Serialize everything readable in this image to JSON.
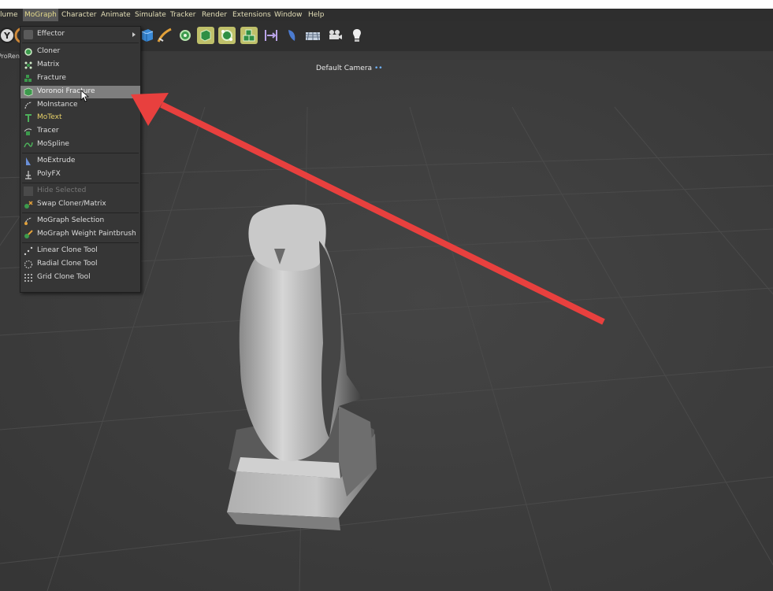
{
  "menubar": {
    "items": [
      {
        "label": "lume"
      },
      {
        "label": "MoGraph",
        "active": true
      },
      {
        "label": "Character"
      },
      {
        "label": "Animate"
      },
      {
        "label": "Simulate"
      },
      {
        "label": "Tracker"
      },
      {
        "label": "Render"
      },
      {
        "label": "Extensions"
      },
      {
        "label": "Window"
      },
      {
        "label": "Help"
      }
    ]
  },
  "toolbar": {
    "icons": [
      "y-axis-icon",
      "rotate-icon",
      "cube-primitive-icon",
      "spline-pen-icon",
      "cloner-icon",
      "extrude-icon",
      "matrix-icon",
      "fracture-icon",
      "joint-icon",
      "deformer-icon",
      "floor-icon",
      "camera-icon",
      "light-icon"
    ]
  },
  "left_stub": {
    "label": "ProRen"
  },
  "viewport": {
    "camera_label": "Default Camera"
  },
  "mograph_menu": {
    "items": [
      {
        "label": "Effector",
        "icon": "effector-icon",
        "submenu": true
      },
      {
        "label": "Cloner",
        "icon": "cloner-icon"
      },
      {
        "label": "Matrix",
        "icon": "matrix-icon"
      },
      {
        "label": "Fracture",
        "icon": "fracture-icon"
      },
      {
        "label": "Voronoi Fracture",
        "icon": "voronoi-fracture-icon",
        "highlighted": true
      },
      {
        "label": "MoInstance",
        "icon": "moinstance-icon"
      },
      {
        "label": "MoText",
        "icon": "motext-icon",
        "yellow": true
      },
      {
        "label": "Tracer",
        "icon": "tracer-icon"
      },
      {
        "label": "MoSpline",
        "icon": "mospline-icon"
      },
      {
        "label": "MoExtrude",
        "icon": "moextrude-icon"
      },
      {
        "label": "PolyFX",
        "icon": "polyfx-icon"
      },
      {
        "label": "Hide Selected",
        "icon": "hide-selected-icon",
        "disabled": true
      },
      {
        "label": "Swap Cloner/Matrix",
        "icon": "swap-icon"
      },
      {
        "label": "MoGraph Selection",
        "icon": "mograph-selection-icon"
      },
      {
        "label": "MoGraph Weight Paintbrush",
        "icon": "weight-paintbrush-icon"
      },
      {
        "label": "Linear Clone Tool",
        "icon": "linear-clone-icon"
      },
      {
        "label": "Radial Clone Tool",
        "icon": "radial-clone-icon"
      },
      {
        "label": "Grid Clone Tool",
        "icon": "grid-clone-icon"
      }
    ]
  },
  "colors": {
    "arrow": "#e8403e",
    "menu_text": "#e4dfb8",
    "highlight": "#7e7e7e"
  }
}
